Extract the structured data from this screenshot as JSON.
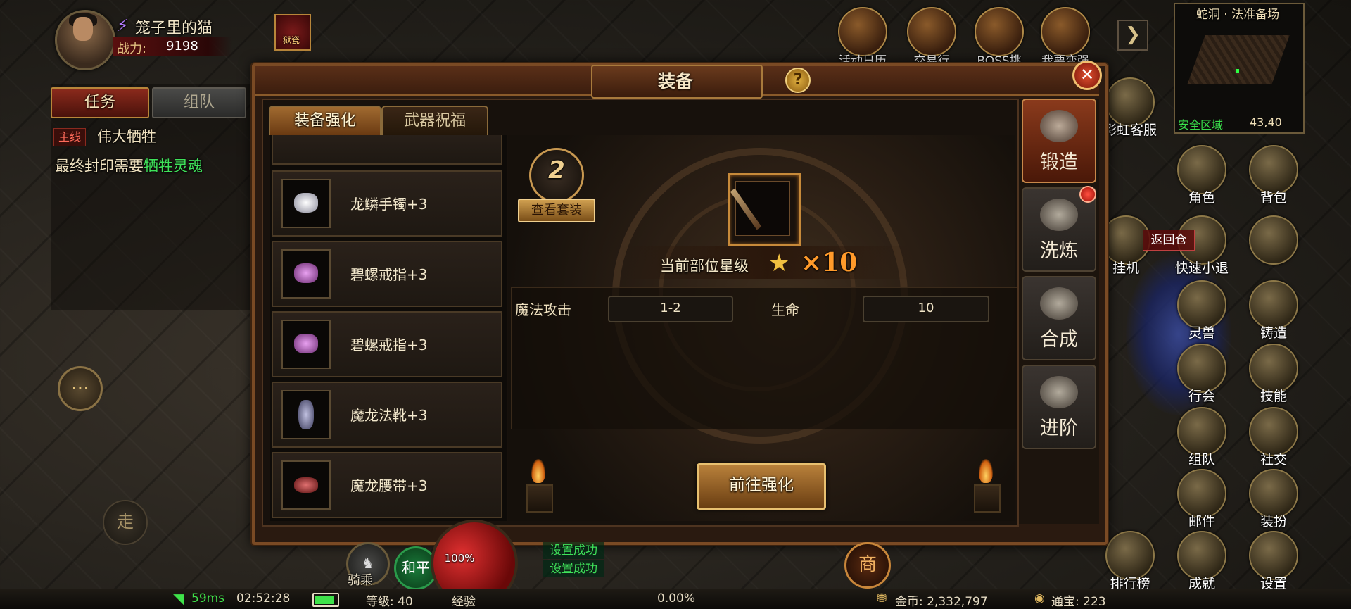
{
  "player": {
    "name": "笼子里的猫",
    "power_label": "战力:",
    "power_value": "9198",
    "buff_label": "狱瓷"
  },
  "task_panel": {
    "tab_task": "任务",
    "tab_team": "组队",
    "main_badge": "主线",
    "main_title": "伟大牺牲",
    "desc_prefix": "最终封印需要",
    "desc_highlight": "牺牲灵魂"
  },
  "top_icons": [
    {
      "label": "活动日历",
      "icon": "calendar-icon"
    },
    {
      "label": "交易行",
      "icon": "scales-icon"
    },
    {
      "label": "BOSS挑战",
      "icon": "boss-icon"
    },
    {
      "label": "我要变强",
      "icon": "fist-icon"
    }
  ],
  "minimap": {
    "title": "蛇洞 · 法准备场",
    "safe_zone": "安全区域",
    "coords": "43,40"
  },
  "side_icons": [
    {
      "label": "角色",
      "icon": "character-icon"
    },
    {
      "label": "背包",
      "icon": "bag-icon"
    },
    {
      "label": "挂机",
      "icon": "autoplay-icon"
    },
    {
      "label": "快速小退",
      "icon": "quick-exit-icon"
    },
    {
      "label": "灵兽",
      "icon": "beast-icon"
    },
    {
      "label": "铸造",
      "icon": "anvil-icon"
    },
    {
      "label": "行会",
      "icon": "guild-icon"
    },
    {
      "label": "技能",
      "icon": "skill-icon"
    },
    {
      "label": "组队",
      "icon": "team-icon"
    },
    {
      "label": "社交",
      "icon": "social-icon"
    },
    {
      "label": "邮件",
      "icon": "mail-icon"
    },
    {
      "label": "装扮",
      "icon": "outfit-icon"
    },
    {
      "label": "排行榜",
      "icon": "ranking-icon"
    },
    {
      "label": "成就",
      "icon": "achievement-icon"
    },
    {
      "label": "设置",
      "icon": "settings-icon"
    }
  ],
  "service_label": "彩虹客服",
  "back_label": "返回仓",
  "modal": {
    "title": "装备",
    "help": "?",
    "close": "✕",
    "tabs": [
      "装备强化",
      "武器祝福"
    ],
    "active_tab": 0,
    "equipment_list": [
      {
        "name": "龙鳞手镯+3",
        "color": "#d8d8e0"
      },
      {
        "name": "碧螺戒指+3",
        "color": "#c070c8"
      },
      {
        "name": "碧螺戒指+3",
        "color": "#c070c8"
      },
      {
        "name": "魔龙法靴+3",
        "color": "#9090b0"
      },
      {
        "name": "魔龙腰带+3",
        "color": "#c05050"
      }
    ],
    "set_count": "2",
    "set_button": "查看套装",
    "star_label": "当前部位星级",
    "star_multiplier": "×10",
    "stats": [
      {
        "label": "魔法攻击",
        "value": "1-2"
      },
      {
        "label": "生命",
        "value": "10"
      }
    ],
    "go_button": "前往强化",
    "side_tabs": [
      {
        "label": "锻造",
        "active": true
      },
      {
        "label": "洗炼",
        "active": false,
        "notify": true
      },
      {
        "label": "合成",
        "active": false
      },
      {
        "label": "进阶",
        "active": false
      }
    ]
  },
  "hud": {
    "ping": "59ms",
    "time": "02:52:28",
    "level": "等级: 40",
    "exp_label": "经验",
    "exp_value": "0.00%",
    "gold": "金币: 2,332,797",
    "treasure": "通宝: 223",
    "hp_pct": "100%",
    "mount_label": "骑乘",
    "peace_label": "和平",
    "shop_label": "商",
    "walk_label": "走",
    "sys_msgs": [
      "设置成功",
      "设置成功"
    ]
  },
  "colors": {
    "accent_gold": "#c8904a",
    "modal_frame": "#7a4a24",
    "highlight_green": "#3fe25a",
    "star_orange": "#ff9a2a"
  }
}
